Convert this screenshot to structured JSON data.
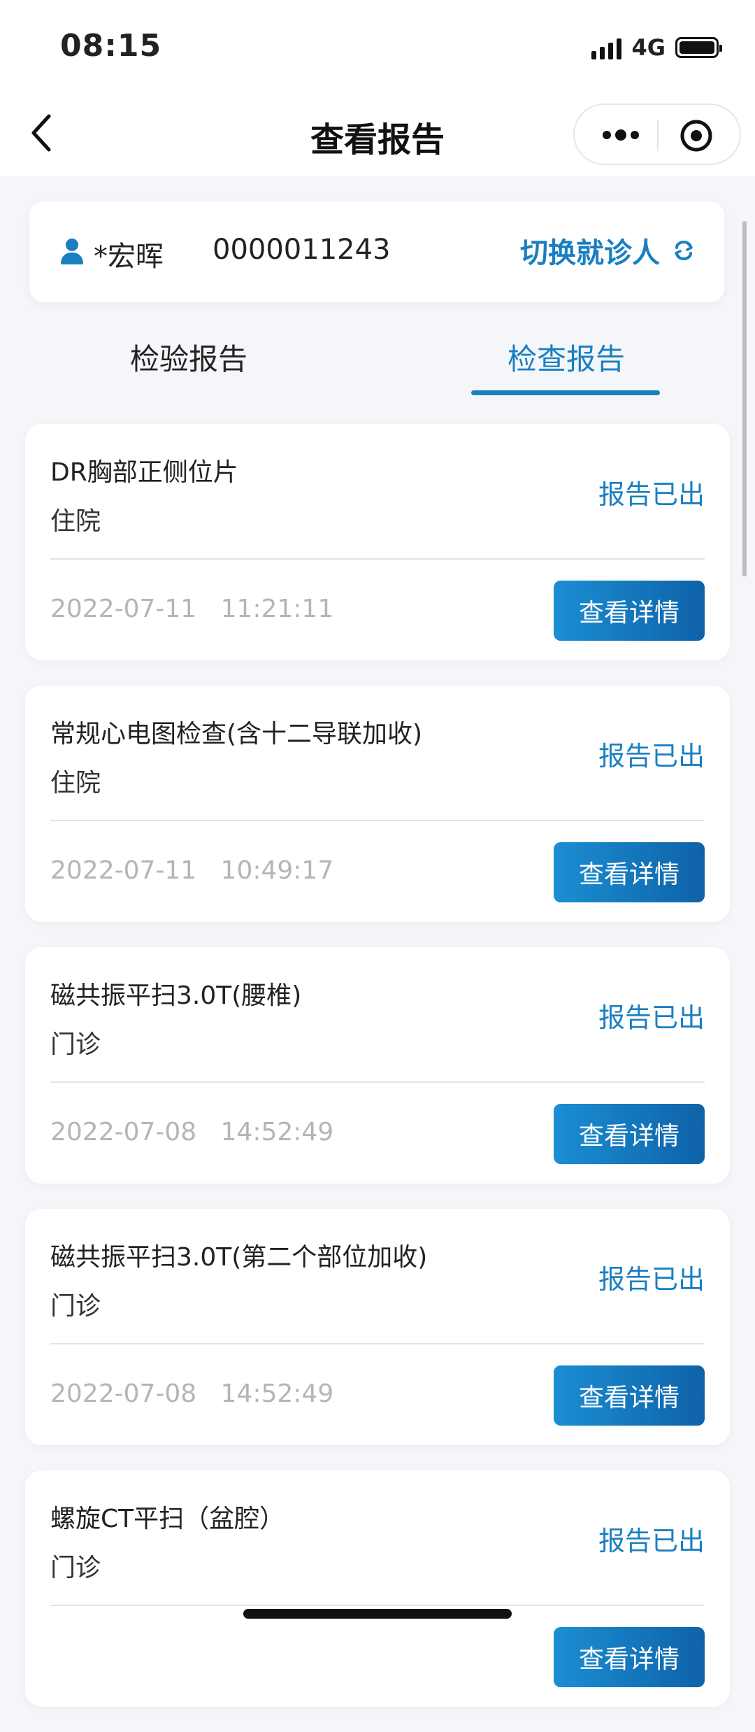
{
  "status_bar": {
    "time": "08:15",
    "network": "4G"
  },
  "nav": {
    "title": "查看报告",
    "back_icon": "chevron-left-icon",
    "more_icon": "more-dots-icon",
    "close_icon": "target-circle-icon"
  },
  "patient": {
    "name": "*宏晖",
    "id": "0000011243",
    "switch_label": "切换就诊人",
    "icon": "person-icon"
  },
  "tabs": [
    {
      "label": "检验报告",
      "active": false
    },
    {
      "label": "检查报告",
      "active": true
    }
  ],
  "reports": [
    {
      "name": "DR胸部正侧位片",
      "type": "住院",
      "status": "报告已出",
      "time": "2022-07-11   11:21:11",
      "button": "查看详情"
    },
    {
      "name": "常规心电图检查(含十二导联加收)",
      "type": "住院",
      "status": "报告已出",
      "time": "2022-07-11   10:49:17",
      "button": "查看详情"
    },
    {
      "name": "磁共振平扫3.0T(腰椎)",
      "type": "门诊",
      "status": "报告已出",
      "time": "2022-07-08   14:52:49",
      "button": "查看详情"
    },
    {
      "name": "磁共振平扫3.0T(第二个部位加收)",
      "type": "门诊",
      "status": "报告已出",
      "time": "2022-07-08   14:52:49",
      "button": "查看详情"
    },
    {
      "name": "螺旋CT平扫（盆腔）",
      "type": "门诊",
      "status": "报告已出",
      "time": "",
      "button": "查看详情"
    }
  ],
  "colors": {
    "accent": "#1a7fc1",
    "button_start": "#1b8ed3",
    "button_end": "#0f62a8",
    "background": "#f4f6f9"
  }
}
